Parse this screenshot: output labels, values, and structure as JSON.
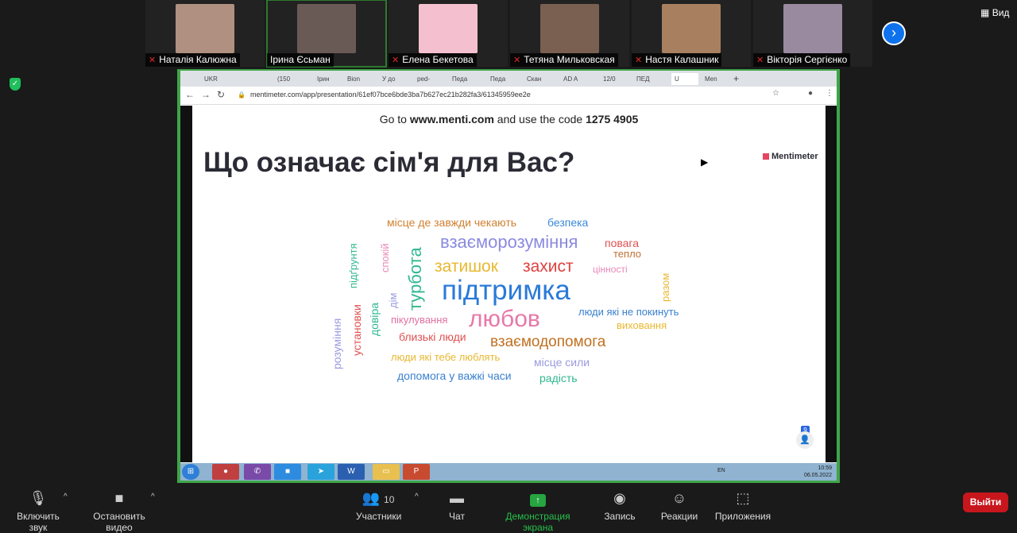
{
  "participants": [
    {
      "name": "Наталія Калюжна",
      "muted": true,
      "color": "#b09080"
    },
    {
      "name": "Ірина Єсьман",
      "muted": false,
      "color": "#6a5a55"
    },
    {
      "name": "Елена Бекетова",
      "muted": true,
      "color": "#f4c0d0"
    },
    {
      "name": "Тетяна Мильковская",
      "muted": true,
      "color": "#7a6050"
    },
    {
      "name": "Настя Калашник",
      "muted": true,
      "color": "#a88060"
    },
    {
      "name": "Вікторія Сергієнко",
      "muted": true,
      "color": "#9a8aa0"
    }
  ],
  "view_label": "Вид",
  "browser": {
    "tabs": [
      "UKR",
      "(150",
      "Ірин",
      "Bion",
      "У до",
      "ped-",
      "Педа",
      "Педа",
      "Скан",
      "AD A",
      "12/0",
      "ПЕД",
      "U",
      "Men"
    ],
    "url": "mentimeter.com/app/presentation/61ef07bce6bde3ba7b627ec21b282fa3/61345959ee2e"
  },
  "slide": {
    "goto_prefix": "Go to",
    "goto_site": "www.menti.com",
    "goto_middle": "and use the code",
    "code": "1275 4905",
    "question": "Що означає сім'я для Вас?",
    "logo": "Mentimeter",
    "participants_count": "9",
    "words": [
      {
        "text": "місце де завжди чекають",
        "color": "#d08030"
      },
      {
        "text": "безпека",
        "color": "#3a8ad8"
      },
      {
        "text": "взаєморозуміння",
        "color": "#8a8ae0"
      },
      {
        "text": "повага",
        "color": "#e05050"
      },
      {
        "text": "тепло",
        "color": "#c07030"
      },
      {
        "text": "затишок",
        "color": "#e8b830"
      },
      {
        "text": "захист",
        "color": "#e04040"
      },
      {
        "text": "цінності",
        "color": "#e888b8"
      },
      {
        "text": "підтримка",
        "color": "#2a7ad8"
      },
      {
        "text": "люди які не покинуть",
        "color": "#3a80d0"
      },
      {
        "text": "виховання",
        "color": "#e8b830"
      },
      {
        "text": "пікулування",
        "color": "#e070a0"
      },
      {
        "text": "любов",
        "color": "#e878a8"
      },
      {
        "text": "близькі люди",
        "color": "#e05050"
      },
      {
        "text": "взаємодопомога",
        "color": "#c07020"
      },
      {
        "text": "люди які тебе люблять",
        "color": "#e8b830"
      },
      {
        "text": "місце сили",
        "color": "#9a9ae0"
      },
      {
        "text": "допомога у важкі часи",
        "color": "#3a80d0"
      },
      {
        "text": "радість",
        "color": "#30b890"
      },
      {
        "text": "підґрунтя",
        "color": "#30b890"
      },
      {
        "text": "спокій",
        "color": "#e888b8"
      },
      {
        "text": "турбота",
        "color": "#30b890"
      },
      {
        "text": "дім",
        "color": "#9a9ae0"
      },
      {
        "text": "довіра",
        "color": "#30b890"
      },
      {
        "text": "установки",
        "color": "#e05050"
      },
      {
        "text": "розуміння",
        "color": "#9a9ae0"
      },
      {
        "text": "разом",
        "color": "#e8b830"
      }
    ]
  },
  "taskbar": {
    "lang": "EN",
    "time": "10:59",
    "date": "06.05.2022"
  },
  "toolbar": {
    "audio": "Включить звук",
    "video": "Остановить видео",
    "participants": "Участники",
    "participants_count": "10",
    "chat": "Чат",
    "share": "Демонстрация экрана",
    "record": "Запись",
    "reactions": "Реакции",
    "apps": "Приложения",
    "exit": "Выйти"
  }
}
